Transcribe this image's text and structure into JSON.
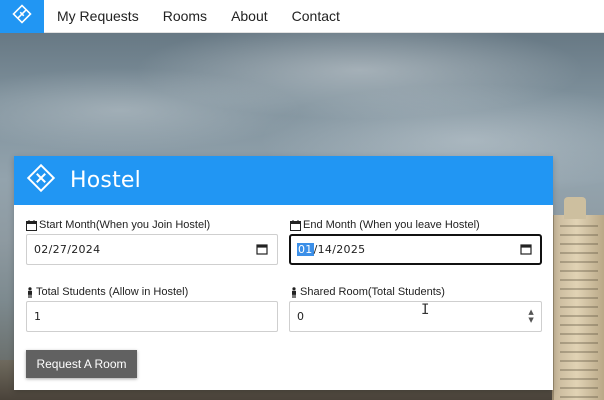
{
  "nav": {
    "brand_icon": "diamond-logo-icon",
    "links": [
      "My Requests",
      "Rooms",
      "About",
      "Contact"
    ]
  },
  "card": {
    "title": "Hostel",
    "logo_icon": "diamond-logo-icon",
    "accent_color": "#2196f3",
    "fields": {
      "start_month": {
        "label": "Start Month(When you Join Hostel)",
        "value": "02/27/2024",
        "icon": "calendar-icon"
      },
      "end_month": {
        "label": "End Month (When you leave Hostel)",
        "value_selected": "01",
        "value_rest": "/14/2025",
        "icon": "calendar-icon"
      },
      "total_students": {
        "label": "Total Students (Allow in Hostel)",
        "value": "1",
        "icon": "person-icon"
      },
      "shared_room": {
        "label": "Shared Room(Total Students)",
        "value": "0",
        "icon": "person-icon"
      }
    },
    "submit_label": "Request A Room"
  }
}
